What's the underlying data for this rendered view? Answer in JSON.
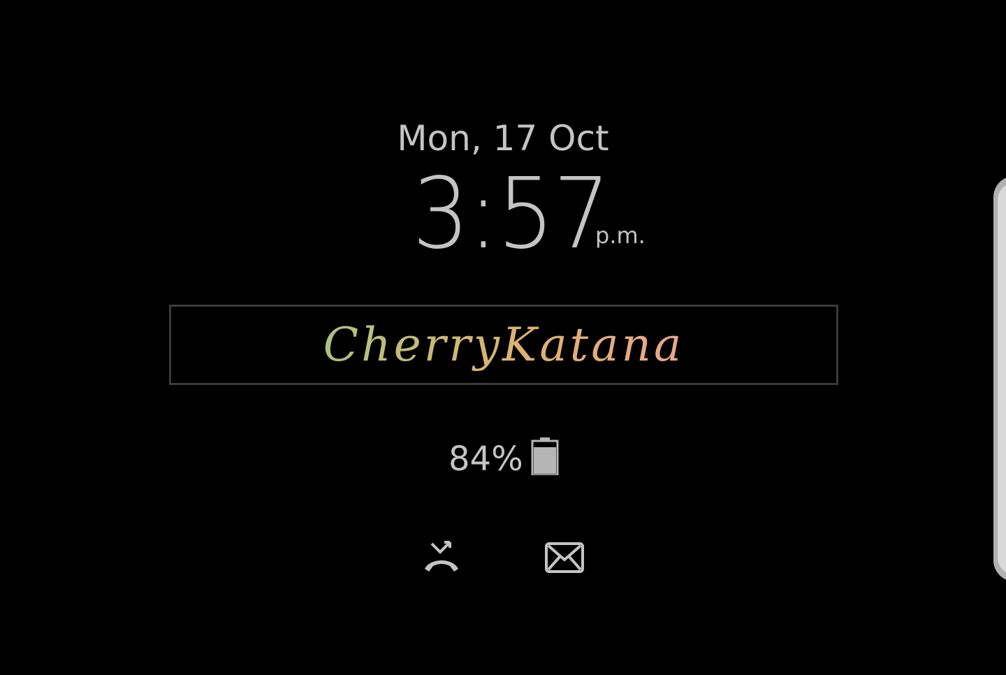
{
  "always_on_display": {
    "date": "Mon, 17 Oct",
    "time": "3:57",
    "ampm": "p.m.",
    "signature": "CherryKatana",
    "battery_text": "84%",
    "battery_level": 84
  },
  "notifications": [
    {
      "icon": "missed-call-icon"
    },
    {
      "icon": "message-icon"
    }
  ],
  "colors": {
    "background": "#000000",
    "text": "#c4c4c4",
    "signature_gradient": [
      "#7fbf8a",
      "#b9c07a",
      "#e0b070",
      "#e7a88a",
      "#d894a8"
    ],
    "edge_handle": "#d9d9d9"
  }
}
